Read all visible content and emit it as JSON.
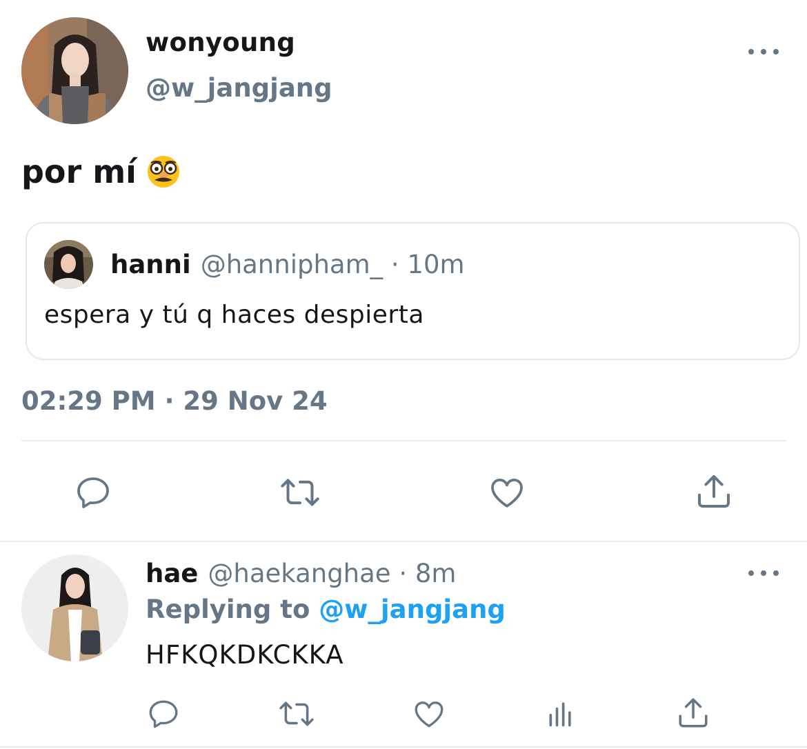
{
  "main_tweet": {
    "author": {
      "display_name": "wonyoung",
      "handle": "@w_jangjang",
      "avatar_icon": "avatar-photo"
    },
    "text": "por mí",
    "emoji_icon": "disguised-face-emoji",
    "more_icon": "more-options-icon",
    "timestamp": "02:29 PM · 29 Nov 24",
    "quoted_tweet": {
      "display_name": "hanni",
      "handle": "@hannipham_ · 10m",
      "text": "espera y tú q haces despierta"
    },
    "actions": [
      "reply-icon",
      "retweet-icon",
      "like-icon",
      "share-icon"
    ]
  },
  "reply_tweet": {
    "display_name": "hae",
    "handle": "@haekanghae · 8m",
    "replying_label": "Replying to",
    "replying_mention": "@w_jangjang",
    "text": "HFKQKDKCKKA",
    "actions": [
      "reply-icon",
      "retweet-icon",
      "like-icon",
      "analytics-icon",
      "share-icon"
    ]
  },
  "colors": {
    "text_primary": "#14171a",
    "text_secondary": "#657786",
    "link": "#1da1f2",
    "border": "#e1e8ed",
    "icon": "#657786"
  }
}
